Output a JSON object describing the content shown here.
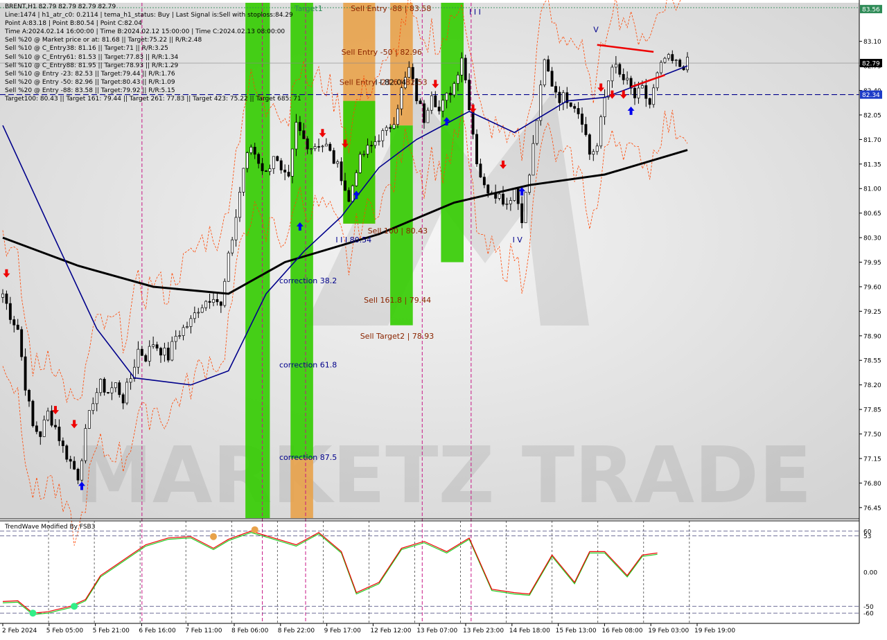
{
  "header": {
    "symbol_line": "BRENT,H1  82.79 82.79 82.79 82.79",
    "info_lines": [
      "Line:1474 | h1_atr_c0: 0.2114 | tema_h1_status: Buy | Last Signal is:Sell with stoploss:84.29",
      "Point A:83.18 | Point B:80.54 | Point C:82.04",
      "Time A:2024.02.14 16:00:00 | Time B:2024.02.12 15:00:00 | Time C:2024.02.13 08:00:00",
      "Sell %20 @ Market price or at: 81.68 || Target:75.22 || R/R:2.48",
      "Sell %10 @ C_Entry38: 81.16 || Target:71 || R/R:3.25",
      "Sell %10 @ C_Entry61: 81.53 || Target:77.83 || R/R:1.34",
      "Sell %10 @ C_Entry88: 81.95 || Target:78.93 || R/R:1.29",
      "Sell %10 @ Entry -23: 82.53 || Target:79.44 || R/R:1.76",
      "Sell %20 @ Entry -50: 82.96 || Target:80.43 || R/R:1.09",
      "Sell %20 @ Entry -88: 83.58 || Target:79.92 || R/R:5.15",
      "Target100: 80.43 || Target 161: 79.44 || Target 261: 77.83 || Target 423: 75.22 || Target 685: 71"
    ],
    "oscillator_title": "TrendWave Modified By FSB3"
  },
  "watermark": "MARKETZ TRADE",
  "colors": {
    "green_zone": "#33cc00",
    "orange_zone": "#e8a24a",
    "ma_black": "#000000",
    "ma_blue": "#00008b",
    "dashed_red": "#ff4500",
    "price_tag_bg": "#000000",
    "top_tag_bg": "#2e8b57",
    "blue_line": "#00008b"
  },
  "chart_data": [
    {
      "type": "candlestick",
      "symbol": "BRENT",
      "timeframe": "H1",
      "ylim": [
        76.3,
        83.65
      ],
      "y_ticks": [
        "83.10",
        "82.75",
        "82.40",
        "82.05",
        "81.70",
        "81.35",
        "81.00",
        "80.65",
        "80.30",
        "79.95",
        "79.60",
        "79.25",
        "78.90",
        "78.55",
        "78.20",
        "77.85",
        "77.50",
        "77.15",
        "76.80",
        "76.45"
      ],
      "x_ticks": [
        "2 Feb 2024",
        "5 Feb 05:00",
        "5 Feb 21:00",
        "6 Feb 16:00",
        "7 Feb 11:00",
        "8 Feb 06:00",
        "8 Feb 22:00",
        "9 Feb 17:00",
        "12 Feb 12:00",
        "13 Feb 07:00",
        "13 Feb 23:00",
        "14 Feb 18:00",
        "15 Feb 13:00",
        "16 Feb 08:00",
        "19 Feb 03:00",
        "19 Feb 19:00"
      ],
      "current_price": "82.79",
      "top_price_tag": "83.56",
      "blue_line_tag": "82.34",
      "close_path": [
        [
          0,
          79.5
        ],
        [
          2,
          79.2
        ],
        [
          4,
          79.0
        ],
        [
          6,
          78.2
        ],
        [
          8,
          77.6
        ],
        [
          10,
          77.5
        ],
        [
          12,
          77.8
        ],
        [
          14,
          77.6
        ],
        [
          16,
          77.3
        ],
        [
          18,
          77.1
        ],
        [
          20,
          76.9
        ],
        [
          22,
          77.5
        ],
        [
          24,
          78.0
        ],
        [
          26,
          78.2
        ],
        [
          28,
          78.1
        ],
        [
          30,
          78.2
        ],
        [
          32,
          78.0
        ],
        [
          34,
          78.3
        ],
        [
          36,
          78.7
        ],
        [
          38,
          78.6
        ],
        [
          40,
          78.8
        ],
        [
          42,
          78.7
        ],
        [
          44,
          78.6
        ],
        [
          46,
          78.9
        ],
        [
          48,
          79.0
        ],
        [
          50,
          79.1
        ],
        [
          52,
          79.3
        ],
        [
          54,
          79.4
        ],
        [
          56,
          79.5
        ],
        [
          58,
          79.3
        ],
        [
          60,
          80.0
        ],
        [
          62,
          80.6
        ],
        [
          64,
          81.3
        ],
        [
          66,
          81.6
        ],
        [
          68,
          81.4
        ],
        [
          70,
          81.2
        ],
        [
          72,
          81.5
        ],
        [
          74,
          81.2
        ],
        [
          76,
          81.1
        ],
        [
          78,
          81.9
        ],
        [
          80,
          81.7
        ],
        [
          82,
          81.6
        ],
        [
          84,
          81.65
        ],
        [
          86,
          81.6
        ],
        [
          88,
          81.4
        ],
        [
          90,
          81.2
        ],
        [
          92,
          80.8
        ],
        [
          94,
          81.3
        ],
        [
          96,
          81.5
        ],
        [
          98,
          81.6
        ],
        [
          100,
          81.75
        ],
        [
          102,
          81.8
        ],
        [
          104,
          82.0
        ],
        [
          106,
          82.4
        ],
        [
          108,
          82.7
        ],
        [
          110,
          82.3
        ],
        [
          112,
          82.0
        ],
        [
          114,
          82.4
        ],
        [
          116,
          82.1
        ],
        [
          118,
          82.3
        ],
        [
          120,
          82.5
        ],
        [
          122,
          82.9
        ],
        [
          124,
          82.2
        ],
        [
          126,
          81.4
        ],
        [
          128,
          81.0
        ],
        [
          130,
          81.0
        ],
        [
          132,
          80.9
        ],
        [
          134,
          80.8
        ],
        [
          136,
          81.0
        ],
        [
          138,
          80.6
        ],
        [
          140,
          81.2
        ],
        [
          142,
          82.0
        ],
        [
          144,
          82.8
        ],
        [
          146,
          82.5
        ],
        [
          148,
          82.3
        ],
        [
          150,
          82.3
        ],
        [
          152,
          82.2
        ],
        [
          154,
          82.0
        ],
        [
          156,
          81.5
        ],
        [
          158,
          81.6
        ],
        [
          160,
          82.3
        ],
        [
          162,
          82.8
        ],
        [
          164,
          82.6
        ],
        [
          166,
          82.5
        ],
        [
          168,
          82.3
        ],
        [
          170,
          82.4
        ],
        [
          172,
          82.2
        ],
        [
          174,
          82.6
        ],
        [
          176,
          82.85
        ],
        [
          178,
          82.8
        ],
        [
          180,
          82.75
        ],
        [
          182,
          82.79
        ]
      ],
      "ma_slow": [
        [
          0,
          80.3
        ],
        [
          20,
          79.9
        ],
        [
          40,
          79.6
        ],
        [
          60,
          79.5
        ],
        [
          75,
          79.95
        ],
        [
          100,
          80.35
        ],
        [
          120,
          80.8
        ],
        [
          140,
          81.05
        ],
        [
          160,
          81.2
        ],
        [
          182,
          81.55
        ]
      ],
      "ma_fast": [
        [
          0,
          81.9
        ],
        [
          12,
          80.5
        ],
        [
          25,
          79.0
        ],
        [
          35,
          78.3
        ],
        [
          50,
          78.2
        ],
        [
          60,
          78.4
        ],
        [
          70,
          79.5
        ],
        [
          80,
          80.1
        ],
        [
          90,
          80.6
        ],
        [
          100,
          81.3
        ],
        [
          110,
          81.7
        ],
        [
          124,
          82.1
        ],
        [
          136,
          81.8
        ],
        [
          150,
          82.25
        ],
        [
          160,
          82.3
        ],
        [
          170,
          82.5
        ],
        [
          182,
          82.75
        ]
      ],
      "zones": [
        {
          "color": "green",
          "x0": 64.5,
          "x1": 71.0,
          "y0": 76.3,
          "y1": 83.65
        },
        {
          "color": "green",
          "x0": 76.5,
          "x1": 82.5,
          "y0": 77.15,
          "y1": 83.65
        },
        {
          "color": "orange",
          "x0": 76.5,
          "x1": 82.5,
          "y0": 76.3,
          "y1": 77.15
        },
        {
          "color": "orange",
          "x0": 90.5,
          "x1": 99.0,
          "y0": 80.5,
          "y1": 83.65
        },
        {
          "color": "green",
          "x0": 90.5,
          "x1": 99.0,
          "y0": 80.5,
          "y1": 82.25
        },
        {
          "color": "orange",
          "x0": 103.0,
          "x1": 109.0,
          "y0": 81.9,
          "y1": 83.65
        },
        {
          "color": "green",
          "x0": 103.0,
          "x1": 109.0,
          "y0": 79.05,
          "y1": 81.9
        },
        {
          "color": "green",
          "x0": 116.5,
          "x1": 122.5,
          "y0": 79.95,
          "y1": 83.65
        }
      ],
      "labels": [
        {
          "text": "Target1",
          "x": 77.5,
          "y": 83.53,
          "color": "#2e8b57"
        },
        {
          "text": "Sell Entry -88 | 83.58",
          "x": 92.5,
          "y": 83.53,
          "color": "#8b2500"
        },
        {
          "text": "Sell Entry -50 | 82.96",
          "x": 90.0,
          "y": 82.91,
          "color": "#8b2500"
        },
        {
          "text": "Sell Entry -23.6 | 82.53",
          "x": 89.5,
          "y": 82.48,
          "color": "#8b2500"
        },
        {
          "text": "Sell 100 | 80.43",
          "x": 97.0,
          "y": 80.36,
          "color": "#8b2500"
        },
        {
          "text": "Sell 161.8 | 79.44",
          "x": 96.0,
          "y": 79.37,
          "color": "#8b2500"
        },
        {
          "text": "Sell Target2 | 78.93",
          "x": 95.0,
          "y": 78.86,
          "color": "#8b2500"
        },
        {
          "text": "correction 38.2",
          "x": 73.5,
          "y": 79.65,
          "color": "#00008b"
        },
        {
          "text": "correction 61.8",
          "x": 73.5,
          "y": 78.45,
          "color": "#00008b"
        },
        {
          "text": "correction 87.5",
          "x": 73.5,
          "y": 77.13,
          "color": "#00008b"
        },
        {
          "text": "I I I 80.54",
          "x": 88.5,
          "y": 80.23,
          "color": "#00008b"
        },
        {
          "text": "I I 82.04",
          "x": 99.0,
          "y": 82.48,
          "color": "#000000"
        },
        {
          "text": "I I I",
          "x": 124.0,
          "y": 83.48,
          "color": "#00008b"
        },
        {
          "text": "I V",
          "x": 135.5,
          "y": 80.23,
          "color": "#00008b"
        },
        {
          "text": "V",
          "x": 157.0,
          "y": 83.23,
          "color": "#00008b"
        }
      ],
      "vertical_red_dashed_x": [
        37,
        69,
        80.5,
        111.5,
        124.5
      ],
      "buy_arrows_x_price": [
        [
          21,
          76.75
        ],
        [
          79,
          80.45
        ],
        [
          94,
          80.9
        ],
        [
          118,
          81.95
        ],
        [
          138,
          80.95
        ],
        [
          167,
          82.1
        ]
      ],
      "sell_arrows_x_price": [
        [
          1,
          79.8
        ],
        [
          14,
          77.85
        ],
        [
          19,
          77.65
        ],
        [
          85,
          81.8
        ],
        [
          91,
          81.65
        ],
        [
          115,
          82.5
        ],
        [
          125,
          82.15
        ],
        [
          133,
          81.35
        ],
        [
          159,
          82.45
        ],
        [
          162,
          82.35
        ],
        [
          165,
          82.35
        ]
      ],
      "n_bars": 183
    },
    {
      "type": "line",
      "title": "TrendWave Modified By FSB3",
      "ylim": [
        -75,
        75
      ],
      "y_ticks": [
        "60",
        "53",
        "0.00",
        "-50",
        "-60"
      ],
      "series_red": [
        [
          0,
          -43
        ],
        [
          4,
          -42
        ],
        [
          8,
          -60
        ],
        [
          12,
          -58
        ],
        [
          18,
          -50
        ],
        [
          22,
          -40
        ],
        [
          26,
          -5
        ],
        [
          30,
          10
        ],
        [
          34,
          25
        ],
        [
          38,
          40
        ],
        [
          44,
          50
        ],
        [
          50,
          52
        ],
        [
          56,
          35
        ],
        [
          60,
          48
        ],
        [
          66,
          60
        ],
        [
          72,
          50
        ],
        [
          78,
          40
        ],
        [
          84,
          58
        ],
        [
          90,
          30
        ],
        [
          94,
          -30
        ],
        [
          100,
          -15
        ],
        [
          106,
          35
        ],
        [
          112,
          45
        ],
        [
          118,
          30
        ],
        [
          124,
          50
        ],
        [
          130,
          -25
        ],
        [
          136,
          -30
        ],
        [
          140,
          -32
        ],
        [
          146,
          25
        ],
        [
          152,
          -15
        ],
        [
          156,
          30
        ],
        [
          160,
          30
        ],
        [
          166,
          -5
        ],
        [
          170,
          25
        ],
        [
          174,
          28
        ]
      ],
      "series_green": [
        [
          0,
          -45
        ],
        [
          4,
          -44
        ],
        [
          8,
          -62
        ],
        [
          12,
          -60
        ],
        [
          18,
          -52
        ],
        [
          22,
          -42
        ],
        [
          26,
          -7
        ],
        [
          30,
          8
        ],
        [
          34,
          23
        ],
        [
          38,
          38
        ],
        [
          44,
          48
        ],
        [
          50,
          50
        ],
        [
          56,
          33
        ],
        [
          60,
          46
        ],
        [
          66,
          58
        ],
        [
          72,
          48
        ],
        [
          78,
          38
        ],
        [
          84,
          56
        ],
        [
          90,
          28
        ],
        [
          94,
          -32
        ],
        [
          100,
          -17
        ],
        [
          106,
          33
        ],
        [
          112,
          43
        ],
        [
          118,
          28
        ],
        [
          124,
          48
        ],
        [
          130,
          -27
        ],
        [
          136,
          -32
        ],
        [
          140,
          -34
        ],
        [
          146,
          23
        ],
        [
          152,
          -17
        ],
        [
          156,
          28
        ],
        [
          160,
          28
        ],
        [
          166,
          -7
        ],
        [
          170,
          23
        ],
        [
          174,
          26
        ]
      ]
    }
  ]
}
